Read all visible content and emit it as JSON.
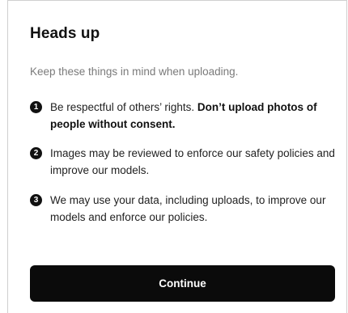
{
  "dialog": {
    "title": "Heads up",
    "subtitle": "Keep these things in mind when uploading.",
    "items": [
      {
        "number": "1",
        "text": "Be respectful of others’ rights. ",
        "bold": "Don’t upload photos of people without consent."
      },
      {
        "number": "2",
        "text": "Images may be reviewed to enforce our safety policies and improve our models."
      },
      {
        "number": "3",
        "text": "We may use your data, including uploads, to improve our models and enforce our policies."
      }
    ],
    "continue_label": "Continue"
  },
  "colors": {
    "button_bg": "#0b0b0b",
    "button_text": "#ffffff",
    "subtitle_text": "#7a7a7a",
    "badge_bg": "#111111"
  }
}
